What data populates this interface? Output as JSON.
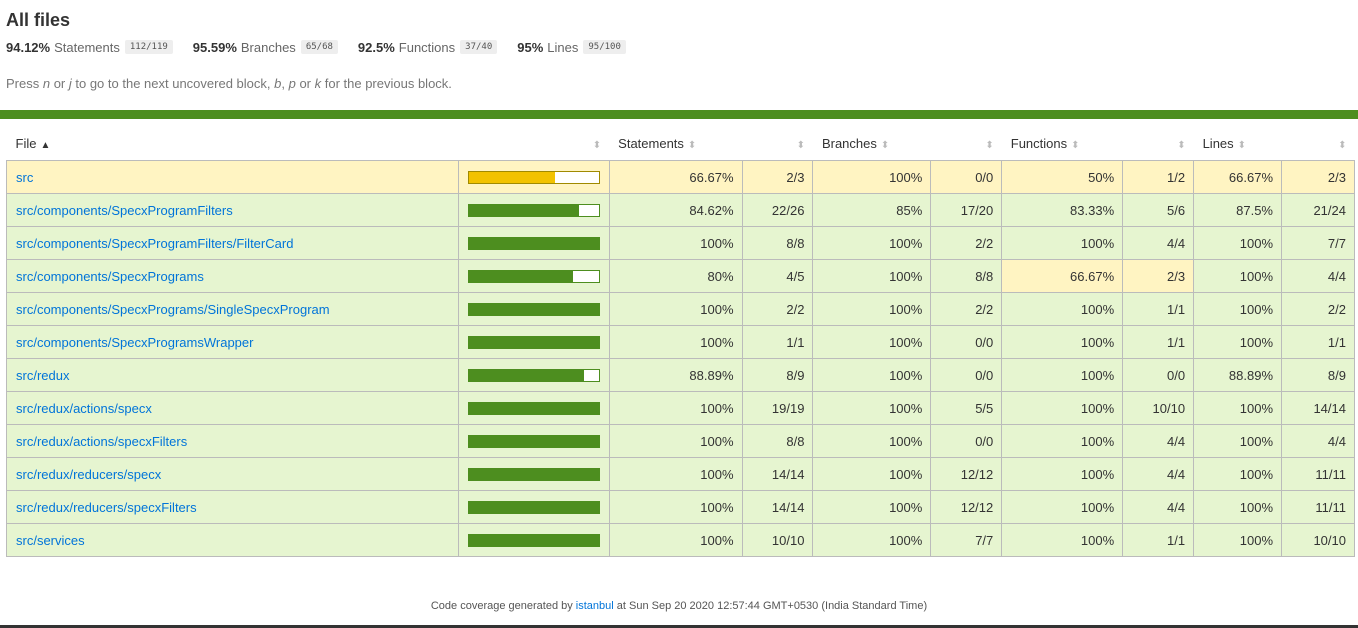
{
  "title": "All files",
  "summary": [
    {
      "pct": "94.12%",
      "label": "Statements",
      "frac": "112/119"
    },
    {
      "pct": "95.59%",
      "label": "Branches",
      "frac": "65/68"
    },
    {
      "pct": "92.5%",
      "label": "Functions",
      "frac": "37/40"
    },
    {
      "pct": "95%",
      "label": "Lines",
      "frac": "95/100"
    }
  ],
  "hint": {
    "t1": "Press ",
    "k1": "n",
    "t2": " or ",
    "k2": "j",
    "t3": " to go to the next uncovered block, ",
    "k3": "b",
    "t4": ", ",
    "k4": "p",
    "t5": " or ",
    "k5": "k",
    "t6": " for the previous block."
  },
  "columns": {
    "file": "File",
    "statements": "Statements",
    "branches": "Branches",
    "functions": "Functions",
    "lines": "Lines"
  },
  "colors": {
    "high": "#e6f5d0",
    "medium": "#fff4c2",
    "bar_high": "#4d8e1f",
    "bar_medium": "#f2c200",
    "link": "#0074d9"
  },
  "rows": [
    {
      "file": "src",
      "coverage": 0.6667,
      "level": "medium",
      "st_pct": "66.67%",
      "st_frac": "2/3",
      "br_pct": "100%",
      "br_frac": "0/0",
      "fn_pct": "50%",
      "fn_frac": "1/2",
      "ln_pct": "66.67%",
      "ln_frac": "2/3",
      "br_level": "medium",
      "fn_level": "medium",
      "ln_level": "medium"
    },
    {
      "file": "src/components/SpecxProgramFilters",
      "coverage": 0.8462,
      "level": "high",
      "st_pct": "84.62%",
      "st_frac": "22/26",
      "br_pct": "85%",
      "br_frac": "17/20",
      "fn_pct": "83.33%",
      "fn_frac": "5/6",
      "ln_pct": "87.5%",
      "ln_frac": "21/24",
      "br_level": "high",
      "fn_level": "high",
      "ln_level": "high"
    },
    {
      "file": "src/components/SpecxProgramFilters/FilterCard",
      "coverage": 1,
      "level": "high",
      "st_pct": "100%",
      "st_frac": "8/8",
      "br_pct": "100%",
      "br_frac": "2/2",
      "fn_pct": "100%",
      "fn_frac": "4/4",
      "ln_pct": "100%",
      "ln_frac": "7/7",
      "br_level": "high",
      "fn_level": "high",
      "ln_level": "high"
    },
    {
      "file": "src/components/SpecxPrograms",
      "coverage": 0.8,
      "level": "high",
      "st_pct": "80%",
      "st_frac": "4/5",
      "br_pct": "100%",
      "br_frac": "8/8",
      "fn_pct": "66.67%",
      "fn_frac": "2/3",
      "ln_pct": "100%",
      "ln_frac": "4/4",
      "br_level": "high",
      "fn_level": "medium",
      "ln_level": "high"
    },
    {
      "file": "src/components/SpecxPrograms/SingleSpecxProgram",
      "coverage": 1,
      "level": "high",
      "st_pct": "100%",
      "st_frac": "2/2",
      "br_pct": "100%",
      "br_frac": "2/2",
      "fn_pct": "100%",
      "fn_frac": "1/1",
      "ln_pct": "100%",
      "ln_frac": "2/2",
      "br_level": "high",
      "fn_level": "high",
      "ln_level": "high"
    },
    {
      "file": "src/components/SpecxProgramsWrapper",
      "coverage": 1,
      "level": "high",
      "st_pct": "100%",
      "st_frac": "1/1",
      "br_pct": "100%",
      "br_frac": "0/0",
      "fn_pct": "100%",
      "fn_frac": "1/1",
      "ln_pct": "100%",
      "ln_frac": "1/1",
      "br_level": "high",
      "fn_level": "high",
      "ln_level": "high"
    },
    {
      "file": "src/redux",
      "coverage": 0.8889,
      "level": "high",
      "st_pct": "88.89%",
      "st_frac": "8/9",
      "br_pct": "100%",
      "br_frac": "0/0",
      "fn_pct": "100%",
      "fn_frac": "0/0",
      "ln_pct": "88.89%",
      "ln_frac": "8/9",
      "br_level": "high",
      "fn_level": "high",
      "ln_level": "high"
    },
    {
      "file": "src/redux/actions/specx",
      "coverage": 1,
      "level": "high",
      "st_pct": "100%",
      "st_frac": "19/19",
      "br_pct": "100%",
      "br_frac": "5/5",
      "fn_pct": "100%",
      "fn_frac": "10/10",
      "ln_pct": "100%",
      "ln_frac": "14/14",
      "br_level": "high",
      "fn_level": "high",
      "ln_level": "high"
    },
    {
      "file": "src/redux/actions/specxFilters",
      "coverage": 1,
      "level": "high",
      "st_pct": "100%",
      "st_frac": "8/8",
      "br_pct": "100%",
      "br_frac": "0/0",
      "fn_pct": "100%",
      "fn_frac": "4/4",
      "ln_pct": "100%",
      "ln_frac": "4/4",
      "br_level": "high",
      "fn_level": "high",
      "ln_level": "high"
    },
    {
      "file": "src/redux/reducers/specx",
      "coverage": 1,
      "level": "high",
      "st_pct": "100%",
      "st_frac": "14/14",
      "br_pct": "100%",
      "br_frac": "12/12",
      "fn_pct": "100%",
      "fn_frac": "4/4",
      "ln_pct": "100%",
      "ln_frac": "11/11",
      "br_level": "high",
      "fn_level": "high",
      "ln_level": "high"
    },
    {
      "file": "src/redux/reducers/specxFilters",
      "coverage": 1,
      "level": "high",
      "st_pct": "100%",
      "st_frac": "14/14",
      "br_pct": "100%",
      "br_frac": "12/12",
      "fn_pct": "100%",
      "fn_frac": "4/4",
      "ln_pct": "100%",
      "ln_frac": "11/11",
      "br_level": "high",
      "fn_level": "high",
      "ln_level": "high"
    },
    {
      "file": "src/services",
      "coverage": 1,
      "level": "high",
      "st_pct": "100%",
      "st_frac": "10/10",
      "br_pct": "100%",
      "br_frac": "7/7",
      "fn_pct": "100%",
      "fn_frac": "1/1",
      "ln_pct": "100%",
      "ln_frac": "10/10",
      "br_level": "high",
      "fn_level": "high",
      "ln_level": "high"
    }
  ],
  "footer": {
    "prefix": "Code coverage generated by ",
    "link": "istanbul",
    "suffix": " at Sun Sep 20 2020 12:57:44 GMT+0530 (India Standard Time)"
  }
}
